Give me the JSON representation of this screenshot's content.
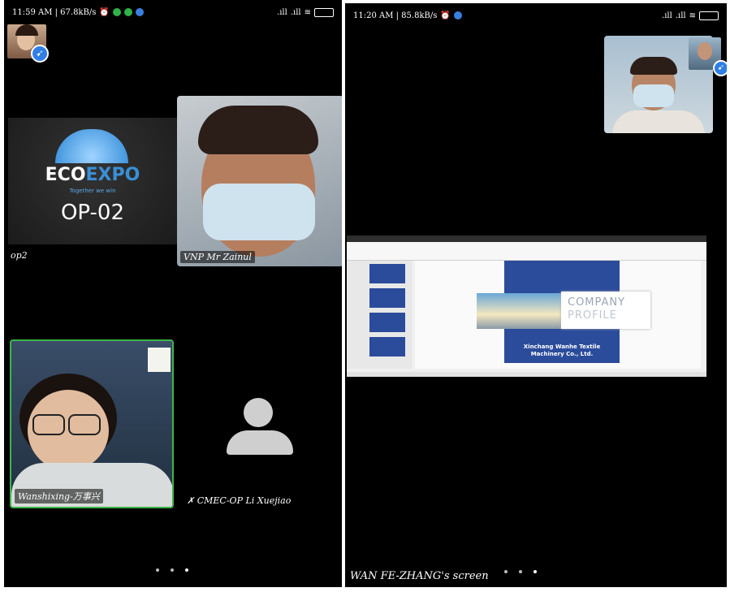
{
  "left": {
    "status_time": "11:59 AM | 67.8kB/s",
    "op_tile": {
      "logo_main": "ECO",
      "logo_accent": "EXPO",
      "tagline": "Together we win",
      "code": "OP-02",
      "label": "op2"
    },
    "mr_zainul_label": "VNP Mr Zainul",
    "wanshixing_label": "Wanshixing-万事兴",
    "xuejiao_label": "CMEC-OP Li Xuejiao"
  },
  "right": {
    "status_time": "11:20 AM | 85.8kB/s",
    "slide": {
      "title_line1": "COMPANY",
      "title_line2": "PROFILE",
      "company_line1": "Xinchang Wanhe Textile",
      "company_line2": "Machinery Co., Ltd."
    },
    "screen_label": "WAN FE-ZHANG's screen"
  },
  "colors": {
    "accent_green": "#3cb54a",
    "slide_blue": "#2b4c9b",
    "brand_blue": "#3a8fd6"
  }
}
